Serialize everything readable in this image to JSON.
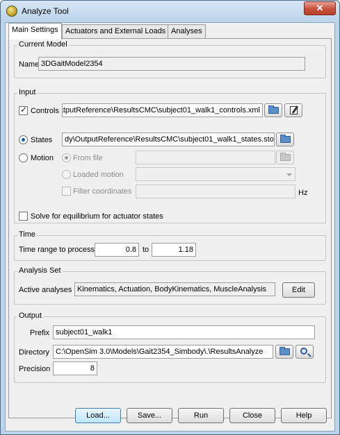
{
  "window": {
    "title": "Analyze Tool",
    "close_glyph": "✕"
  },
  "tabs": [
    "Main Settings",
    "Actuators and External Loads",
    "Analyses"
  ],
  "current_model": {
    "group_title": "Current Model",
    "name_label": "Name",
    "name_value": "3DGaitModel2354"
  },
  "input": {
    "group_title": "Input",
    "controls": {
      "label": "Controls",
      "checked": true,
      "path": "ɩtputReference\\ResultsCMC\\subject01_walk1_controls.xml"
    },
    "states": {
      "label": "States",
      "selected": true,
      "path": "dy\\OutputReference\\ResultsCMC\\subject01_walk1_states.sto"
    },
    "motion": {
      "label": "Motion",
      "selected": false
    },
    "from_file": {
      "label": "From file",
      "path": ""
    },
    "loaded_motion": {
      "label": "Loaded motion",
      "value": ""
    },
    "filter_coordinates": {
      "label": "Filter coordinates",
      "value": "",
      "unit": "Hz"
    },
    "solve_equilibrium": {
      "label": "Solve for equilibrium for actuator states",
      "checked": false
    }
  },
  "time": {
    "group_title": "Time",
    "range_label": "Time range to process",
    "start": "0.8",
    "to_label": "to",
    "end": "1.18"
  },
  "analysis_set": {
    "group_title": "Analysis Set",
    "active_label": "Active analyses",
    "active_value": "Kinematics, Actuation, BodyKinematics, MuscleAnalysis",
    "edit_label": "Edit"
  },
  "output": {
    "group_title": "Output",
    "prefix_label": "Prefix",
    "prefix_value": "subject01_walk1",
    "directory_label": "Directory",
    "directory_value": "C:\\OpenSim 3.0\\Models\\Gait2354_Simbody\\.\\ResultsAnalyze",
    "precision_label": "Precision",
    "precision_value": "8"
  },
  "buttons": {
    "load": "Load...",
    "save": "Save...",
    "run": "Run",
    "close": "Close",
    "help": "Help"
  }
}
